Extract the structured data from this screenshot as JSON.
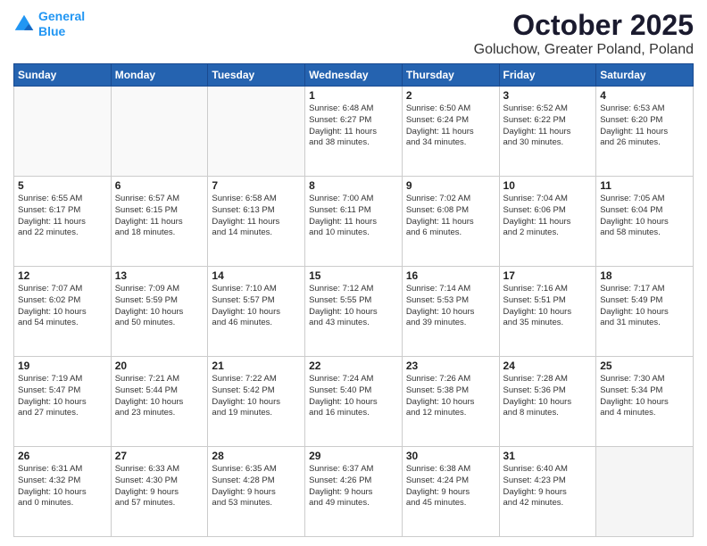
{
  "header": {
    "logo_line1": "General",
    "logo_line2": "Blue",
    "title": "October 2025",
    "subtitle": "Goluchow, Greater Poland, Poland"
  },
  "weekdays": [
    "Sunday",
    "Monday",
    "Tuesday",
    "Wednesday",
    "Thursday",
    "Friday",
    "Saturday"
  ],
  "rows": [
    [
      {
        "day": "",
        "lines": []
      },
      {
        "day": "",
        "lines": []
      },
      {
        "day": "",
        "lines": []
      },
      {
        "day": "1",
        "lines": [
          "Sunrise: 6:48 AM",
          "Sunset: 6:27 PM",
          "Daylight: 11 hours",
          "and 38 minutes."
        ]
      },
      {
        "day": "2",
        "lines": [
          "Sunrise: 6:50 AM",
          "Sunset: 6:24 PM",
          "Daylight: 11 hours",
          "and 34 minutes."
        ]
      },
      {
        "day": "3",
        "lines": [
          "Sunrise: 6:52 AM",
          "Sunset: 6:22 PM",
          "Daylight: 11 hours",
          "and 30 minutes."
        ]
      },
      {
        "day": "4",
        "lines": [
          "Sunrise: 6:53 AM",
          "Sunset: 6:20 PM",
          "Daylight: 11 hours",
          "and 26 minutes."
        ]
      }
    ],
    [
      {
        "day": "5",
        "lines": [
          "Sunrise: 6:55 AM",
          "Sunset: 6:17 PM",
          "Daylight: 11 hours",
          "and 22 minutes."
        ]
      },
      {
        "day": "6",
        "lines": [
          "Sunrise: 6:57 AM",
          "Sunset: 6:15 PM",
          "Daylight: 11 hours",
          "and 18 minutes."
        ]
      },
      {
        "day": "7",
        "lines": [
          "Sunrise: 6:58 AM",
          "Sunset: 6:13 PM",
          "Daylight: 11 hours",
          "and 14 minutes."
        ]
      },
      {
        "day": "8",
        "lines": [
          "Sunrise: 7:00 AM",
          "Sunset: 6:11 PM",
          "Daylight: 11 hours",
          "and 10 minutes."
        ]
      },
      {
        "day": "9",
        "lines": [
          "Sunrise: 7:02 AM",
          "Sunset: 6:08 PM",
          "Daylight: 11 hours",
          "and 6 minutes."
        ]
      },
      {
        "day": "10",
        "lines": [
          "Sunrise: 7:04 AM",
          "Sunset: 6:06 PM",
          "Daylight: 11 hours",
          "and 2 minutes."
        ]
      },
      {
        "day": "11",
        "lines": [
          "Sunrise: 7:05 AM",
          "Sunset: 6:04 PM",
          "Daylight: 10 hours",
          "and 58 minutes."
        ]
      }
    ],
    [
      {
        "day": "12",
        "lines": [
          "Sunrise: 7:07 AM",
          "Sunset: 6:02 PM",
          "Daylight: 10 hours",
          "and 54 minutes."
        ]
      },
      {
        "day": "13",
        "lines": [
          "Sunrise: 7:09 AM",
          "Sunset: 5:59 PM",
          "Daylight: 10 hours",
          "and 50 minutes."
        ]
      },
      {
        "day": "14",
        "lines": [
          "Sunrise: 7:10 AM",
          "Sunset: 5:57 PM",
          "Daylight: 10 hours",
          "and 46 minutes."
        ]
      },
      {
        "day": "15",
        "lines": [
          "Sunrise: 7:12 AM",
          "Sunset: 5:55 PM",
          "Daylight: 10 hours",
          "and 43 minutes."
        ]
      },
      {
        "day": "16",
        "lines": [
          "Sunrise: 7:14 AM",
          "Sunset: 5:53 PM",
          "Daylight: 10 hours",
          "and 39 minutes."
        ]
      },
      {
        "day": "17",
        "lines": [
          "Sunrise: 7:16 AM",
          "Sunset: 5:51 PM",
          "Daylight: 10 hours",
          "and 35 minutes."
        ]
      },
      {
        "day": "18",
        "lines": [
          "Sunrise: 7:17 AM",
          "Sunset: 5:49 PM",
          "Daylight: 10 hours",
          "and 31 minutes."
        ]
      }
    ],
    [
      {
        "day": "19",
        "lines": [
          "Sunrise: 7:19 AM",
          "Sunset: 5:47 PM",
          "Daylight: 10 hours",
          "and 27 minutes."
        ]
      },
      {
        "day": "20",
        "lines": [
          "Sunrise: 7:21 AM",
          "Sunset: 5:44 PM",
          "Daylight: 10 hours",
          "and 23 minutes."
        ]
      },
      {
        "day": "21",
        "lines": [
          "Sunrise: 7:22 AM",
          "Sunset: 5:42 PM",
          "Daylight: 10 hours",
          "and 19 minutes."
        ]
      },
      {
        "day": "22",
        "lines": [
          "Sunrise: 7:24 AM",
          "Sunset: 5:40 PM",
          "Daylight: 10 hours",
          "and 16 minutes."
        ]
      },
      {
        "day": "23",
        "lines": [
          "Sunrise: 7:26 AM",
          "Sunset: 5:38 PM",
          "Daylight: 10 hours",
          "and 12 minutes."
        ]
      },
      {
        "day": "24",
        "lines": [
          "Sunrise: 7:28 AM",
          "Sunset: 5:36 PM",
          "Daylight: 10 hours",
          "and 8 minutes."
        ]
      },
      {
        "day": "25",
        "lines": [
          "Sunrise: 7:30 AM",
          "Sunset: 5:34 PM",
          "Daylight: 10 hours",
          "and 4 minutes."
        ]
      }
    ],
    [
      {
        "day": "26",
        "lines": [
          "Sunrise: 6:31 AM",
          "Sunset: 4:32 PM",
          "Daylight: 10 hours",
          "and 0 minutes."
        ]
      },
      {
        "day": "27",
        "lines": [
          "Sunrise: 6:33 AM",
          "Sunset: 4:30 PM",
          "Daylight: 9 hours",
          "and 57 minutes."
        ]
      },
      {
        "day": "28",
        "lines": [
          "Sunrise: 6:35 AM",
          "Sunset: 4:28 PM",
          "Daylight: 9 hours",
          "and 53 minutes."
        ]
      },
      {
        "day": "29",
        "lines": [
          "Sunrise: 6:37 AM",
          "Sunset: 4:26 PM",
          "Daylight: 9 hours",
          "and 49 minutes."
        ]
      },
      {
        "day": "30",
        "lines": [
          "Sunrise: 6:38 AM",
          "Sunset: 4:24 PM",
          "Daylight: 9 hours",
          "and 45 minutes."
        ]
      },
      {
        "day": "31",
        "lines": [
          "Sunrise: 6:40 AM",
          "Sunset: 4:23 PM",
          "Daylight: 9 hours",
          "and 42 minutes."
        ]
      },
      {
        "day": "",
        "lines": []
      }
    ]
  ]
}
